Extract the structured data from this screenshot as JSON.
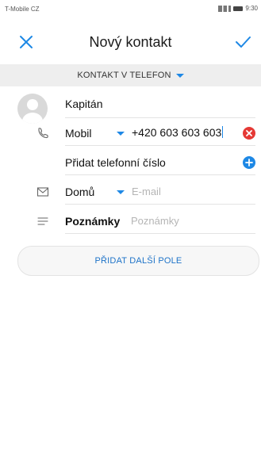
{
  "status_bar": {
    "carrier": "T-Mobile CZ",
    "time": "9:30"
  },
  "header": {
    "title": "Nový kontakt"
  },
  "account": {
    "label": "KONTAKT V TELEFON"
  },
  "contact": {
    "name": "Kapitán"
  },
  "phone": {
    "type": "Mobil",
    "number": "+420 603 603 603"
  },
  "add_phone": {
    "label": "Přidat telefonní číslo"
  },
  "email": {
    "type": "Domů",
    "placeholder": "E-mail"
  },
  "notes": {
    "label": "Poznámky",
    "placeholder": "Poznámky"
  },
  "add_field": {
    "label": "PŘIDAT DALŠÍ POLE"
  },
  "colors": {
    "accent": "#1e88e5",
    "delete": "#e53935",
    "add": "#1e88e5"
  },
  "icons": [
    "close-icon",
    "check-icon",
    "phone-icon",
    "mail-icon",
    "notes-icon",
    "clear-icon",
    "plus-icon"
  ]
}
